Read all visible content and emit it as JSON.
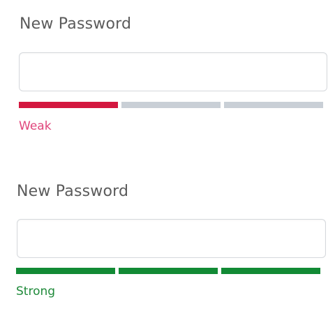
{
  "fields": [
    {
      "label": "New Password",
      "value": "",
      "placeholder": "",
      "strength_label": "Weak",
      "strength_level": 1,
      "segments_total": 3,
      "strength_color": "#d3173f",
      "label_color": "#e0457b",
      "empty_color": "#c9cfd6"
    },
    {
      "label": "New Password",
      "value": "",
      "placeholder": "",
      "strength_label": "Strong",
      "strength_level": 3,
      "segments_total": 3,
      "strength_color": "#128a35",
      "label_color": "#1f8a3a",
      "empty_color": "#c9cfd6"
    }
  ]
}
